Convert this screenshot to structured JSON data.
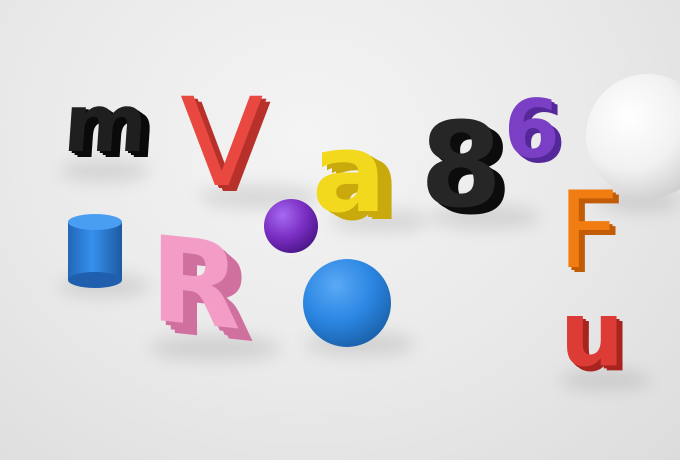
{
  "scene": {
    "background": "#e8e8e8",
    "objects": [
      {
        "kind": "letter",
        "text": "m",
        "color": "#1f1f1f",
        "shade": "#0a0a0a"
      },
      {
        "kind": "letter",
        "text": "V",
        "color": "#e8483f",
        "shade": "#b8302a"
      },
      {
        "kind": "letter",
        "text": "a",
        "color": "#f2d91e",
        "shade": "#c9a90c"
      },
      {
        "kind": "letter",
        "text": "8",
        "color": "#262626",
        "shade": "#0c0c0c"
      },
      {
        "kind": "letter",
        "text": "6",
        "color": "#7a3fc4",
        "shade": "#55289a"
      },
      {
        "kind": "letter",
        "text": "F",
        "color": "#f07c12",
        "shade": "#c25c05"
      },
      {
        "kind": "letter",
        "text": "u",
        "color": "#dd3b35",
        "shade": "#a8241f"
      },
      {
        "kind": "letter",
        "text": "R",
        "color": "#f29cc6",
        "shade": "#d0709f"
      },
      {
        "kind": "sphere",
        "name": "white-sphere",
        "color": "#ffffff"
      },
      {
        "kind": "sphere",
        "name": "purple-sphere",
        "color": "#7b2fc4"
      },
      {
        "kind": "sphere",
        "name": "blue-sphere",
        "color": "#2b86e2"
      },
      {
        "kind": "cylinder",
        "name": "blue-cylinder",
        "color": "#2f7fd9"
      }
    ]
  }
}
